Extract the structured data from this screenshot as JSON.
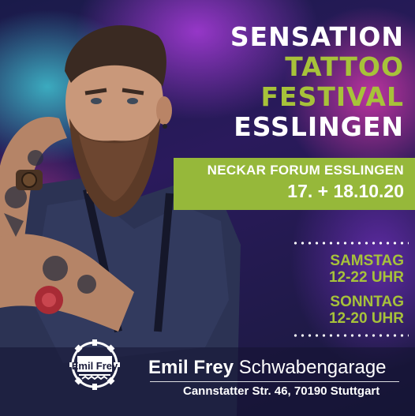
{
  "title": {
    "line1": "SENSATION",
    "line2": "TATTOO",
    "line3": "FESTIVAL",
    "line4": "ESSLINGEN"
  },
  "venue": {
    "name": "NECKAR FORUM ESSLINGEN",
    "dates": "17. + 18.10.20"
  },
  "schedule": [
    {
      "day": "SAMSTAG",
      "hours": "12-22 UHR"
    },
    {
      "day": "SONNTAG",
      "hours": "12-20 UHR"
    }
  ],
  "sponsor": {
    "logo_text": "Emil Frey",
    "name_bold": "Emil Frey",
    "name_regular": "Schwabengarage",
    "address": "Cannstatter Str. 46, 70190 Stuttgart"
  },
  "colors": {
    "accent_green": "#a7c23a",
    "band_green": "#96b83a",
    "text_white": "#ffffff"
  }
}
